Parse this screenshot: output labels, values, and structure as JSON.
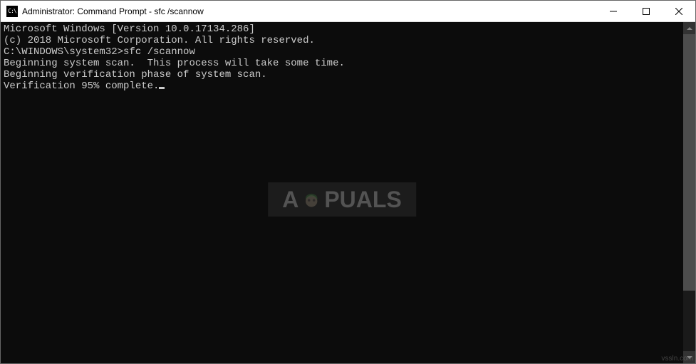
{
  "window": {
    "title": "Administrator: Command Prompt - sfc  /scannow",
    "icon_label": "cmd-icon"
  },
  "terminal": {
    "lines": {
      "l0": "Microsoft Windows [Version 10.0.17134.286]",
      "l1": "(c) 2018 Microsoft Corporation. All rights reserved.",
      "l2": "",
      "l3": "C:\\WINDOWS\\system32>sfc /scannow",
      "l4": "",
      "l5": "Beginning system scan.  This process will take some time.",
      "l6": "",
      "l7": "Beginning verification phase of system scan.",
      "l8": "Verification 95% complete."
    }
  },
  "watermark": {
    "text_before": "A",
    "text_after": "PUALS"
  },
  "footer": {
    "source": "vssln.com"
  }
}
